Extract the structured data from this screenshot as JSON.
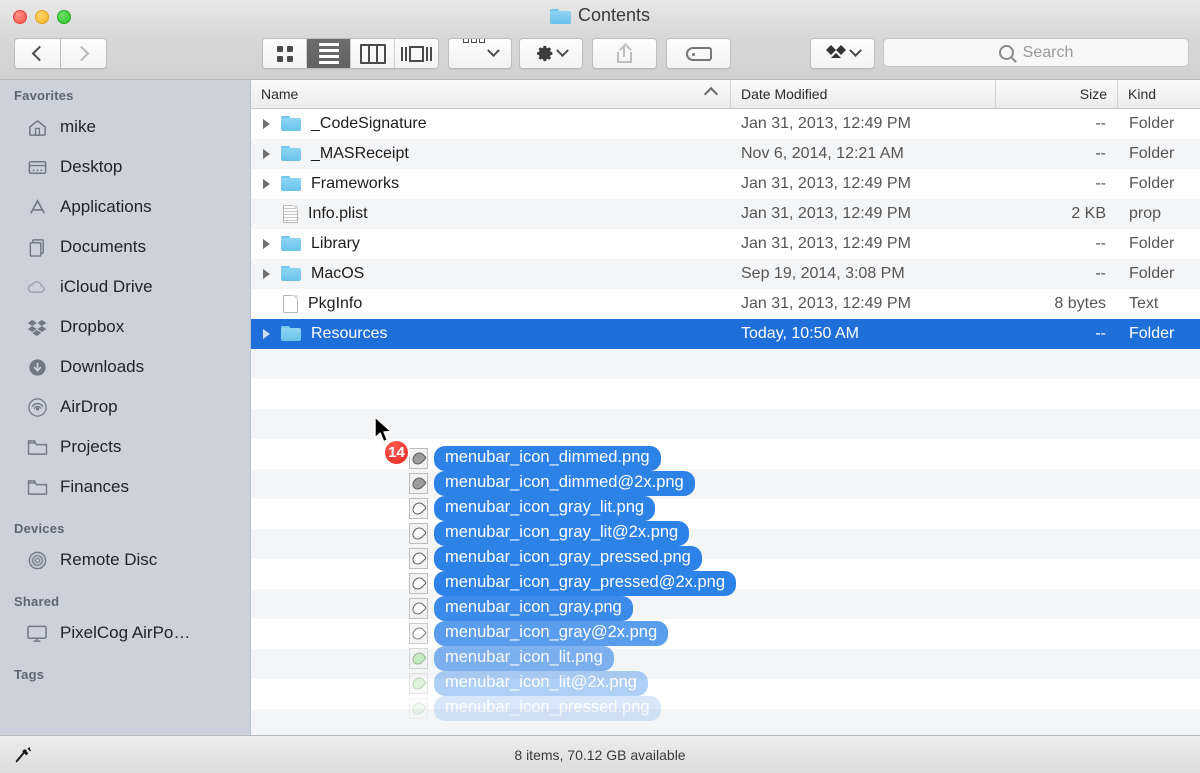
{
  "window": {
    "title": "Contents",
    "title_icon": "folder-icon",
    "traffic_lights": [
      "close-button",
      "minimize-button",
      "maximize-button"
    ]
  },
  "toolbar": {
    "back_label": "Back",
    "forward_label": "Forward",
    "view_modes": [
      {
        "name": "icon-view-button",
        "icon": "grid-icon",
        "active": false
      },
      {
        "name": "list-view-button",
        "icon": "list-icon",
        "active": true
      },
      {
        "name": "column-view-button",
        "icon": "columns-icon",
        "active": false
      },
      {
        "name": "coverflow-view-button",
        "icon": "coverflow-icon",
        "active": false
      }
    ],
    "arrange_label": "Arrange",
    "arrange_icon": "arrange-icon",
    "action_label": "Action",
    "action_icon": "gear-icon",
    "share_label": "Share",
    "share_icon": "share-icon",
    "tag_label": "Tags",
    "tag_icon": "tag-icon",
    "dropbox_label": "Dropbox",
    "dropbox_icon": "dropbox-icon"
  },
  "search": {
    "placeholder": "Search",
    "value": "",
    "icon": "search-icon"
  },
  "sidebar": {
    "sections": [
      {
        "header": "Favorites",
        "items": [
          {
            "label": "mike",
            "icon": "home-icon"
          },
          {
            "label": "Desktop",
            "icon": "desktop-icon"
          },
          {
            "label": "Applications",
            "icon": "applications-icon"
          },
          {
            "label": "Documents",
            "icon": "documents-icon"
          },
          {
            "label": "iCloud Drive",
            "icon": "cloud-icon"
          },
          {
            "label": "Dropbox",
            "icon": "dropbox-icon"
          },
          {
            "label": "Downloads",
            "icon": "downloads-icon"
          },
          {
            "label": "AirDrop",
            "icon": "airdrop-icon"
          },
          {
            "label": "Projects",
            "icon": "folder-icon"
          },
          {
            "label": "Finances",
            "icon": "folder-icon"
          }
        ]
      },
      {
        "header": "Devices",
        "items": [
          {
            "label": "Remote Disc",
            "icon": "disc-icon"
          }
        ]
      },
      {
        "header": "Shared",
        "items": [
          {
            "label": "PixelCog AirPo…",
            "icon": "display-icon"
          }
        ]
      },
      {
        "header": "Tags",
        "items": []
      }
    ]
  },
  "filelist": {
    "columns": [
      {
        "key": "name",
        "label": "Name",
        "sorted": true,
        "sort_direction": "ascending"
      },
      {
        "key": "date",
        "label": "Date Modified"
      },
      {
        "key": "size",
        "label": "Size"
      },
      {
        "key": "kind",
        "label": "Kind"
      }
    ],
    "rows": [
      {
        "name": "_CodeSignature",
        "date": "Jan 31, 2013, 12:49 PM",
        "size": "--",
        "kind": "Folder",
        "icon": "folder-icon",
        "expandable": true,
        "selected": false
      },
      {
        "name": "_MASReceipt",
        "date": "Nov 6, 2014, 12:21 AM",
        "size": "--",
        "kind": "Folder",
        "icon": "folder-icon",
        "expandable": true,
        "selected": false
      },
      {
        "name": "Frameworks",
        "date": "Jan 31, 2013, 12:49 PM",
        "size": "--",
        "kind": "Folder",
        "icon": "folder-icon",
        "expandable": true,
        "selected": false
      },
      {
        "name": "Info.plist",
        "date": "Jan 31, 2013, 12:49 PM",
        "size": "2 KB",
        "kind": "prop",
        "icon": "plist-file-icon",
        "expandable": false,
        "selected": false
      },
      {
        "name": "Library",
        "date": "Jan 31, 2013, 12:49 PM",
        "size": "--",
        "kind": "Folder",
        "icon": "folder-icon",
        "expandable": true,
        "selected": false
      },
      {
        "name": "MacOS",
        "date": "Sep 19, 2014, 3:08 PM",
        "size": "--",
        "kind": "Folder",
        "icon": "folder-icon",
        "expandable": true,
        "selected": false
      },
      {
        "name": "PkgInfo",
        "date": "Jan 31, 2013, 12:49 PM",
        "size": "8 bytes",
        "kind": "Text",
        "icon": "document-icon",
        "expandable": false,
        "selected": false
      },
      {
        "name": "Resources",
        "date": "Today, 10:50 AM",
        "size": "--",
        "kind": "Folder",
        "icon": "folder-icon",
        "expandable": true,
        "selected": true
      }
    ]
  },
  "drag": {
    "badge_count": "14",
    "items": [
      {
        "label": "menubar_icon_dimmed.png",
        "icon_variant": "dim",
        "opacity": 1
      },
      {
        "label": "menubar_icon_dimmed@2x.png",
        "icon_variant": "dim",
        "opacity": 1
      },
      {
        "label": "menubar_icon_gray_lit.png",
        "icon_variant": "gray",
        "opacity": 1
      },
      {
        "label": "menubar_icon_gray_lit@2x.png",
        "icon_variant": "gray",
        "opacity": 1
      },
      {
        "label": "menubar_icon_gray_pressed.png",
        "icon_variant": "gray",
        "opacity": 1
      },
      {
        "label": "menubar_icon_gray_pressed@2x.png",
        "icon_variant": "gray",
        "opacity": 1
      },
      {
        "label": "menubar_icon_gray.png",
        "icon_variant": "gray",
        "opacity": 0.92
      },
      {
        "label": "menubar_icon_gray@2x.png",
        "icon_variant": "gray",
        "opacity": 0.78
      },
      {
        "label": "menubar_icon_lit.png",
        "icon_variant": "lit",
        "opacity": 0.6
      },
      {
        "label": "menubar_icon_lit@2x.png",
        "icon_variant": "lit",
        "opacity": 0.38
      },
      {
        "label": "menubar_icon_pressed.png",
        "icon_variant": "lit",
        "opacity": 0.18
      }
    ]
  },
  "statusbar": {
    "text": "8 items, 70.12 GB available",
    "icon": "pen-path-icon"
  },
  "colors": {
    "selection_blue": "#1e6fd9",
    "drag_label_blue": "#2d82e8",
    "badge_red": "#e8281c",
    "sidebar_bg": "#cbd2dc",
    "folder_blue": "#73c7ee"
  }
}
